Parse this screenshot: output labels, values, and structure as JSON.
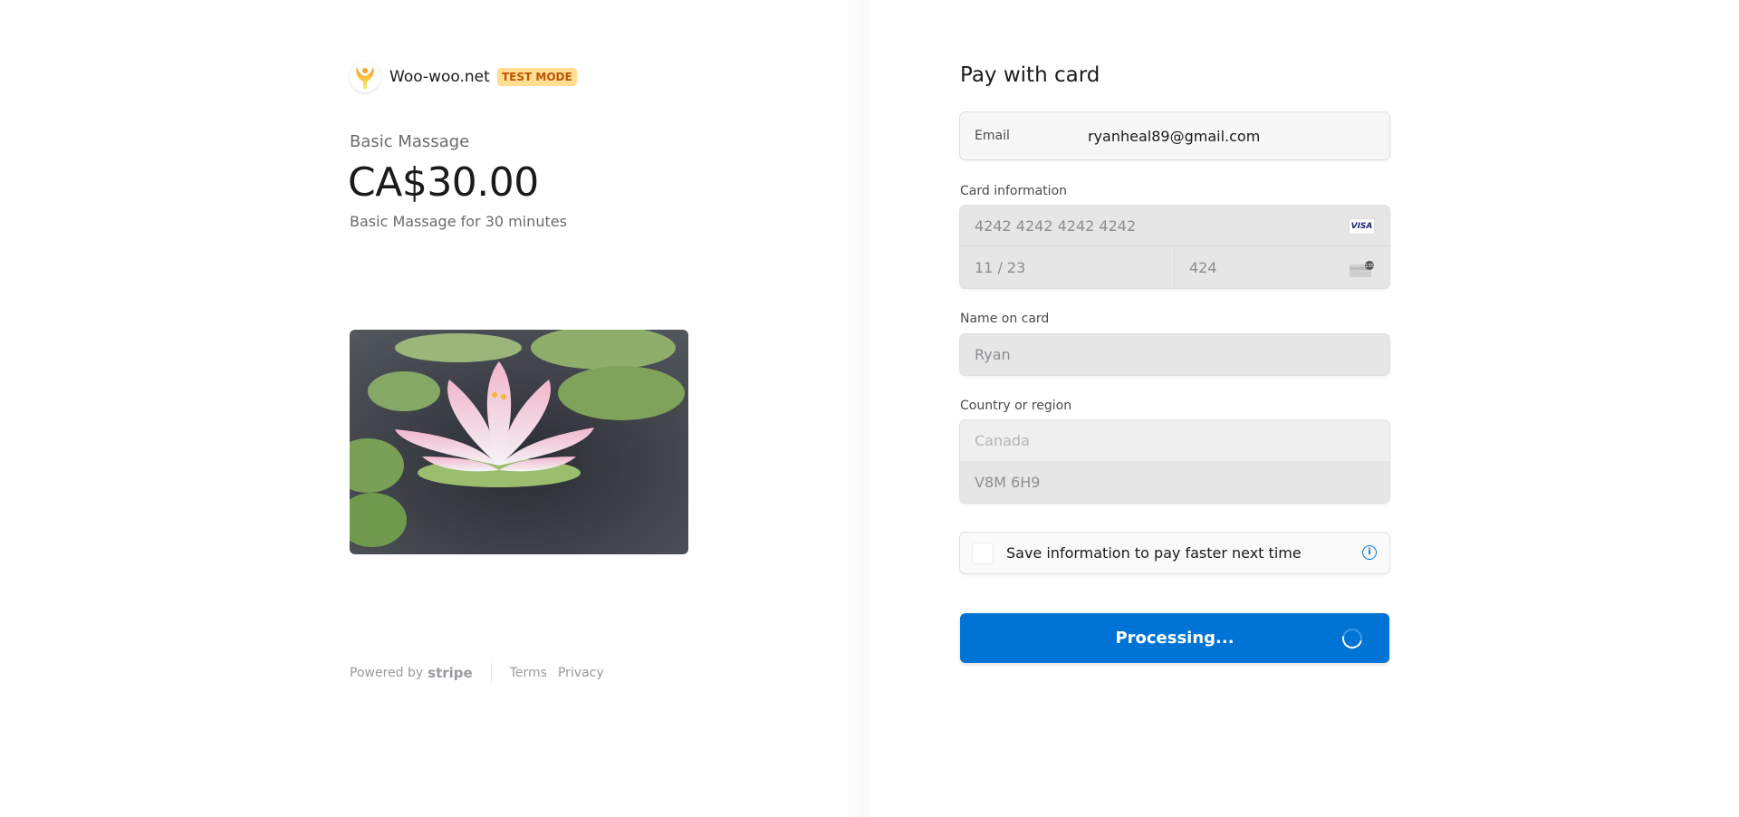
{
  "merchant": {
    "name": "Woo-woo.net",
    "badge": "TEST MODE"
  },
  "product": {
    "name": "Basic Massage",
    "price": "CA$30.00",
    "description": "Basic Massage for 30 minutes",
    "image": "lotus-flower-photo"
  },
  "footer": {
    "powered_by": "Powered by",
    "stripe": "stripe",
    "terms": "Terms",
    "privacy": "Privacy"
  },
  "form": {
    "title": "Pay with card",
    "email": {
      "label": "Email",
      "value": "ryanheal89@gmail.com"
    },
    "card": {
      "label": "Card information",
      "number": "4242 4242 4242 4242",
      "brand": "VISA",
      "expiry": "11 / 23",
      "cvc": "424"
    },
    "name": {
      "label": "Name on card",
      "value": "Ryan"
    },
    "country": {
      "label": "Country or region",
      "value": "Canada",
      "postal": "V8M 6H9"
    },
    "save": {
      "label": "Save information to pay faster next time",
      "checked": false
    },
    "submit": {
      "label": "Processing..."
    }
  },
  "colors": {
    "accent": "#0074d4",
    "badge_bg": "#ffde92",
    "badge_text": "#bb5504"
  }
}
